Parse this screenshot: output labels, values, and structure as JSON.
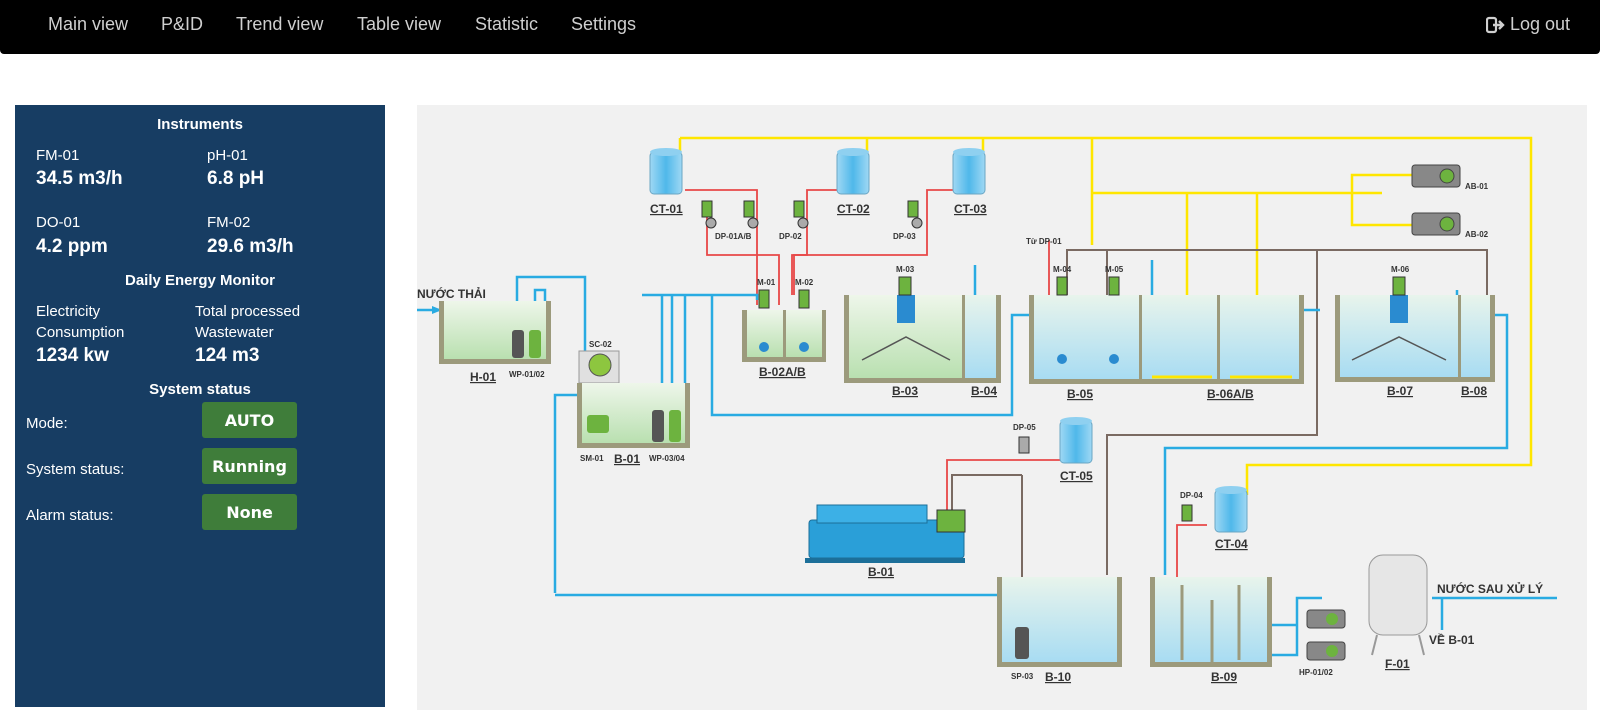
{
  "nav": {
    "items": [
      "Main view",
      "P&ID",
      "Trend view",
      "Table view",
      "Statistic",
      "Settings"
    ],
    "logout": "Log out"
  },
  "instruments": {
    "title": "Instruments",
    "items": [
      {
        "name": "FM-01",
        "value": "34.5 m3/h"
      },
      {
        "name": "pH-01",
        "value": "6.8 pH"
      },
      {
        "name": "DO-01",
        "value": "4.2 ppm"
      },
      {
        "name": "FM-02",
        "value": "29.6 m3/h"
      }
    ]
  },
  "energy": {
    "title": "Daily Energy Monitor",
    "electricity_label_1": "Electricity",
    "electricity_label_2": "Consumption",
    "electricity_value": "1234 kw",
    "wastewater_label_1": "Total processed",
    "wastewater_label_2": "Wastewater",
    "wastewater_value": "124 m3"
  },
  "system": {
    "title": "System status",
    "mode_label": "Mode:",
    "mode_value": "AUTO",
    "status_label": "System status:",
    "status_value": "Running",
    "alarm_label": "Alarm status:",
    "alarm_value": "None",
    "badge_color": "#3f7d3a"
  },
  "colors": {
    "nav_bg": "#000000",
    "panel_bg": "#173d63",
    "water_line": "#29abe2",
    "air_line": "#ffe600",
    "chem_line": "#e84848",
    "sludge_line": "#7a6a62"
  },
  "diagram": {
    "inlet": "NƯỚC THẢI",
    "outlet": "NƯỚC SAU XỬ LÝ",
    "return": "VỀ B-01",
    "from_dp01": "Từ DP-01",
    "tanks": {
      "h01": "H-01",
      "b01": "B-01",
      "b02": "B-02A/B",
      "b03": "B-03",
      "b04": "B-04",
      "b05": "B-05",
      "b06": "B-06A/B",
      "b07": "B-07",
      "b08": "B-08",
      "b09": "B-09",
      "b10": "B-10",
      "b01_press": "B-01",
      "f01": "F-01"
    },
    "chem_tanks": {
      "ct01": "CT-01",
      "ct02": "CT-02",
      "ct03": "CT-03",
      "ct04": "CT-04",
      "ct05": "CT-05"
    },
    "equipment": {
      "wp0102": "WP-01/02",
      "wp0304": "WP-03/04",
      "sm01": "SM-01",
      "sc02": "SC-02",
      "dp01ab": "DP-01A/B",
      "dp02": "DP-02",
      "dp03": "DP-03",
      "dp04": "DP-04",
      "dp05": "DP-05",
      "m01": "M-01",
      "m02": "M-02",
      "m03": "M-03",
      "m04": "M-04",
      "m05": "M-05",
      "m06": "M-06",
      "ab01": "AB-01",
      "ab02": "AB-02",
      "sp03": "SP-03",
      "hp0102": "HP-01/02"
    }
  }
}
